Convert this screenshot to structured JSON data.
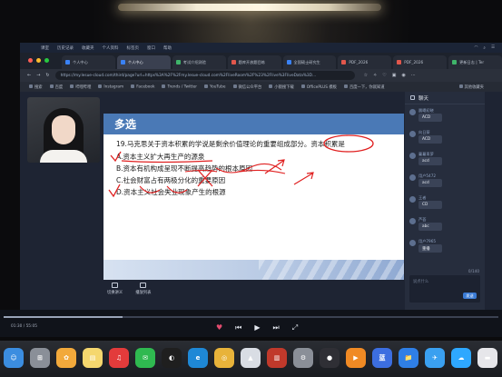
{
  "colors": {
    "slide_header": "#4a79b6",
    "ink": "#e02020",
    "chat_bg": "#262d3d",
    "page_bg": "#1e2433",
    "send_button": "#3a7bd5"
  },
  "menubar": {
    "items": [
      "课室",
      "历史记录",
      "收藏夹",
      "个人资料",
      "标签页",
      "窗口",
      "帮助"
    ]
  },
  "tabs": [
    {
      "label": "个人中心",
      "active": false
    },
    {
      "label": "个人中心",
      "active": true
    },
    {
      "label": "考试介绍测验",
      "active": false
    },
    {
      "label": "题库开放题目练",
      "active": false
    },
    {
      "label": "全国硕士研究生",
      "active": false
    },
    {
      "label": "PDF_2026",
      "active": false
    },
    {
      "label": "PDF_2026",
      "active": false
    },
    {
      "label": "更新日志 | Ter",
      "active": false
    }
  ],
  "address": {
    "url": "https://my.lesue-cloud.com/third/page?url=https%3A%2F%2Fmy.lesue-cloud.com%2FliveRoom%2F%23%2Flive%3FliveData%3D..."
  },
  "bookmarks": {
    "items": [
      "搜索",
      "百度",
      "哔哩哔哩",
      "Instagram",
      "Facebook",
      "Trends / Twitter",
      "YouTube",
      "微信公众平台",
      "小猿搜下载",
      "OfficePLUS 模板",
      "百度一下，你就知道"
    ],
    "other": "其他收藏夹"
  },
  "slide": {
    "tag": "多选",
    "question": "19.马克思关于资本积累的学说是剩余价值理论的重要组成部分。资本积累是",
    "options": [
      "A.资本主义扩大再生产的源泉",
      "B.资本有机构成呈现不断提高趋势的根本原因",
      "C.社会财富占有两极分化的重要原因",
      "D.资本主义社会失业现象产生的根源"
    ]
  },
  "page_tools": [
    "切换讲义",
    "播放列表"
  ],
  "chat": {
    "title": "聊天",
    "messages": [
      {
        "name": "晨曦初晓",
        "text": "ACD"
      },
      {
        "name": "向日葵",
        "text": "ACD"
      },
      {
        "name": "蔓蔓青萝",
        "text": "acd"
      },
      {
        "name": "用户5472",
        "text": "acd"
      },
      {
        "name": "王者",
        "text": "CD"
      },
      {
        "name": "芦荟",
        "text": "abc"
      },
      {
        "name": "用户7965",
        "text": "重播"
      }
    ],
    "counter": "0/140",
    "placeholder": "说点什么",
    "send": "发送"
  },
  "player": {
    "elapsed": "01:30",
    "total": "55:05",
    "progress": 0.24
  },
  "dock": {
    "apps": [
      "finder-icon",
      "launchpad-icon",
      "photos-icon",
      "notes-icon",
      "netease-music-icon",
      "wechat-icon",
      "qq-icon",
      "edge-icon",
      "chrome-icon",
      "rocket-icon",
      "photo-booth-icon",
      "preferences-icon",
      "screen-recorder-icon",
      "infuse-icon",
      "lanhu-icon",
      "finder-files-icon",
      "bluebird-icon",
      "baidu-netdisk-icon",
      "scrubber-icon"
    ]
  }
}
